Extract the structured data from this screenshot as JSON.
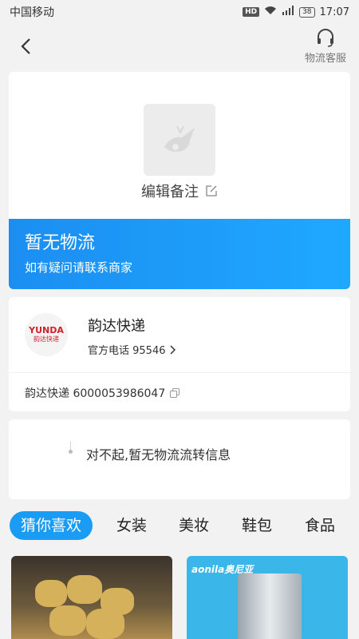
{
  "status_bar": {
    "carrier": "中国移动",
    "hd": "HD",
    "network": "4G",
    "battery": "38",
    "time": "17:07"
  },
  "nav": {
    "back_icon": "chevron-left-icon",
    "service_icon": "headset-icon",
    "service_label": "物流客服"
  },
  "package": {
    "remark_label": "编辑备注",
    "remark_icon": "edit-icon",
    "placeholder_icon": "bird-placeholder-icon"
  },
  "no_logistics": {
    "title": "暂无物流",
    "subtitle": "如有疑问请联系商家"
  },
  "courier": {
    "logo_text": "YUNDA",
    "logo_sub": "韵达快递",
    "name": "韵达快递",
    "phone": "官方电话 95546",
    "tracking": "韵达快递 6000053986047",
    "copy_icon": "copy-icon"
  },
  "info": {
    "text": "对不起,暂无物流流转信息"
  },
  "tabs": [
    {
      "label": "猜你喜欢",
      "active": true
    },
    {
      "label": "女装",
      "active": false
    },
    {
      "label": "美妆",
      "active": false
    },
    {
      "label": "鞋包",
      "active": false
    },
    {
      "label": "食品",
      "active": false
    }
  ],
  "products": [
    {
      "name": "product-image-food"
    },
    {
      "name": "product-image-cooker",
      "brand": "aonila奥尼亚"
    }
  ],
  "colors": {
    "accent": "#1a9cf5",
    "banner_start": "#1b8ef2",
    "banner_end": "#1fa8ff",
    "yunda_red": "#d2202d"
  }
}
